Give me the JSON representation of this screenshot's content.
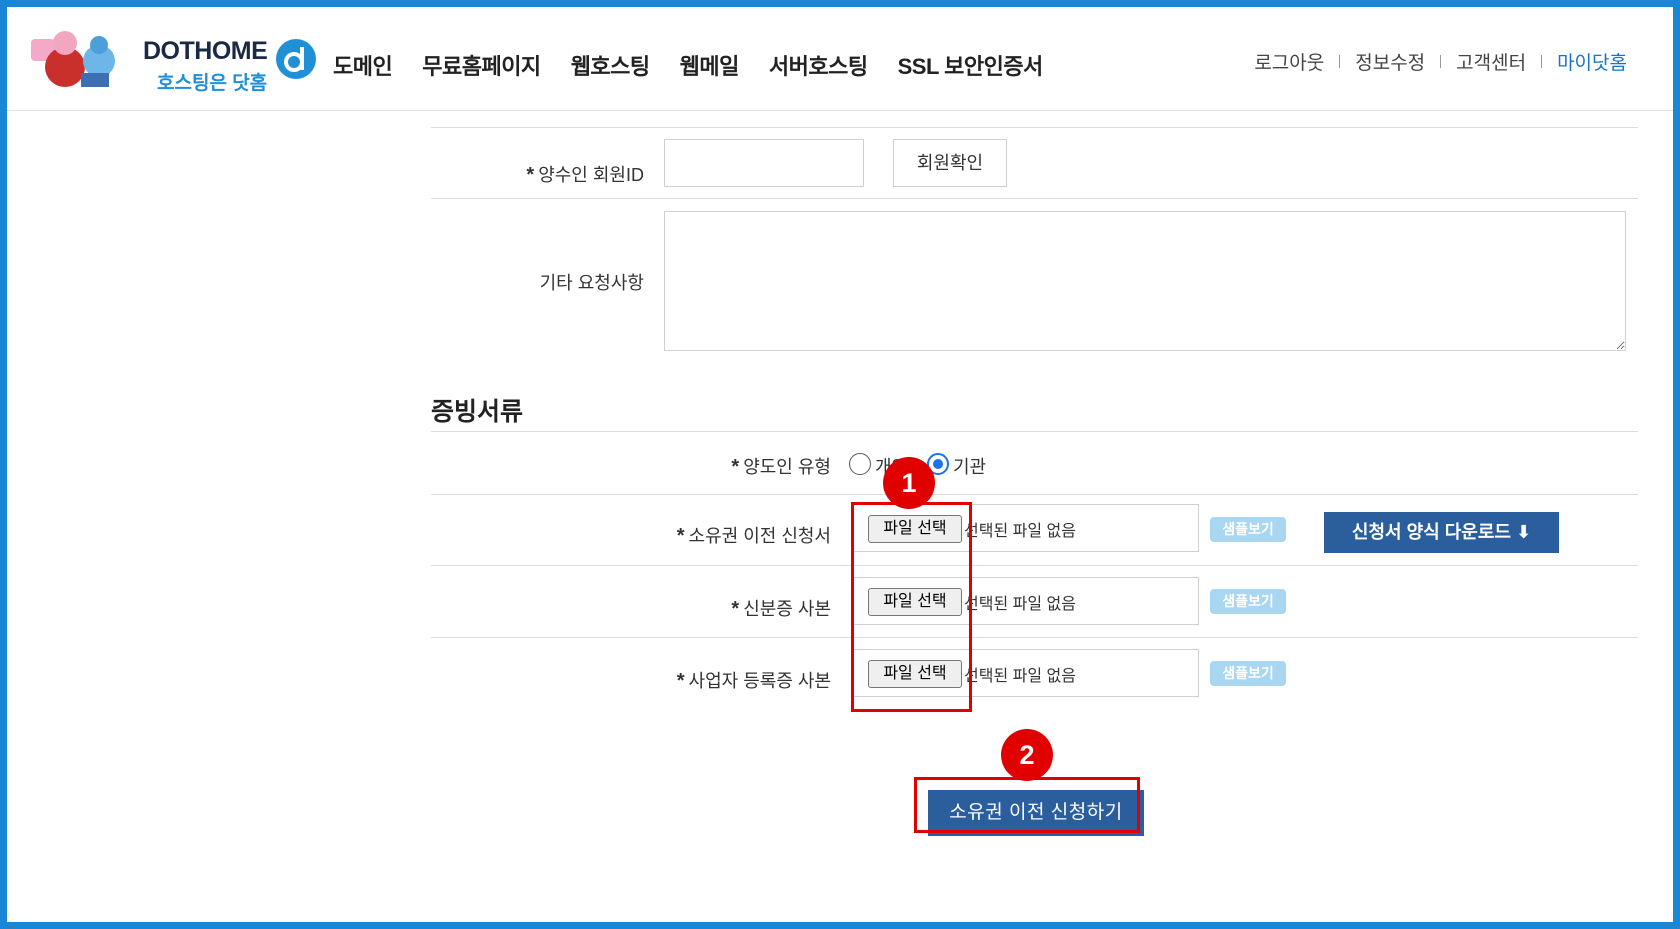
{
  "header": {
    "brand": "DOTHOME",
    "tagline": "호스팅은 닷홈",
    "nav": [
      "도메인",
      "무료홈페이지",
      "웹호스팅",
      "웹메일",
      "서버호스팅",
      "SSL 보안인증서"
    ],
    "util": {
      "logout": "로그아웃",
      "edit_info": "정보수정",
      "support": "고객센터",
      "myhome": "마이닷홈"
    }
  },
  "form": {
    "transferee_label": "양수인 회원ID",
    "transferee_value": "",
    "verify_button": "회원확인",
    "notes_label": "기타 요청사항",
    "notes_value": ""
  },
  "documents": {
    "section_title": "증빙서류",
    "transferor_type_label": "양도인 유형",
    "options": [
      "개인",
      "기관"
    ],
    "selected_option": "기관",
    "rows": [
      {
        "label": "소유권 이전 신청서",
        "file_button": "파일 선택",
        "file_status": "선택된 파일 없음",
        "sample": "샘플보기"
      },
      {
        "label": "신분증 사본",
        "file_button": "파일 선택",
        "file_status": "선택된 파일 없음",
        "sample": "샘플보기"
      },
      {
        "label": "사업자 등록증 사본",
        "file_button": "파일 선택",
        "file_status": "선택된 파일 없음",
        "sample": "샘플보기"
      }
    ],
    "download_button": "신청서 양식 다운로드"
  },
  "submit_button": "소유권 이전 신청하기",
  "annotations": [
    "1",
    "2"
  ],
  "colors": {
    "frame": "#1a87d6",
    "primary_button": "#2b5e9c",
    "sample_badge": "#a9d6f1",
    "annotation": "#e00000",
    "link_active": "#1a73c6"
  }
}
